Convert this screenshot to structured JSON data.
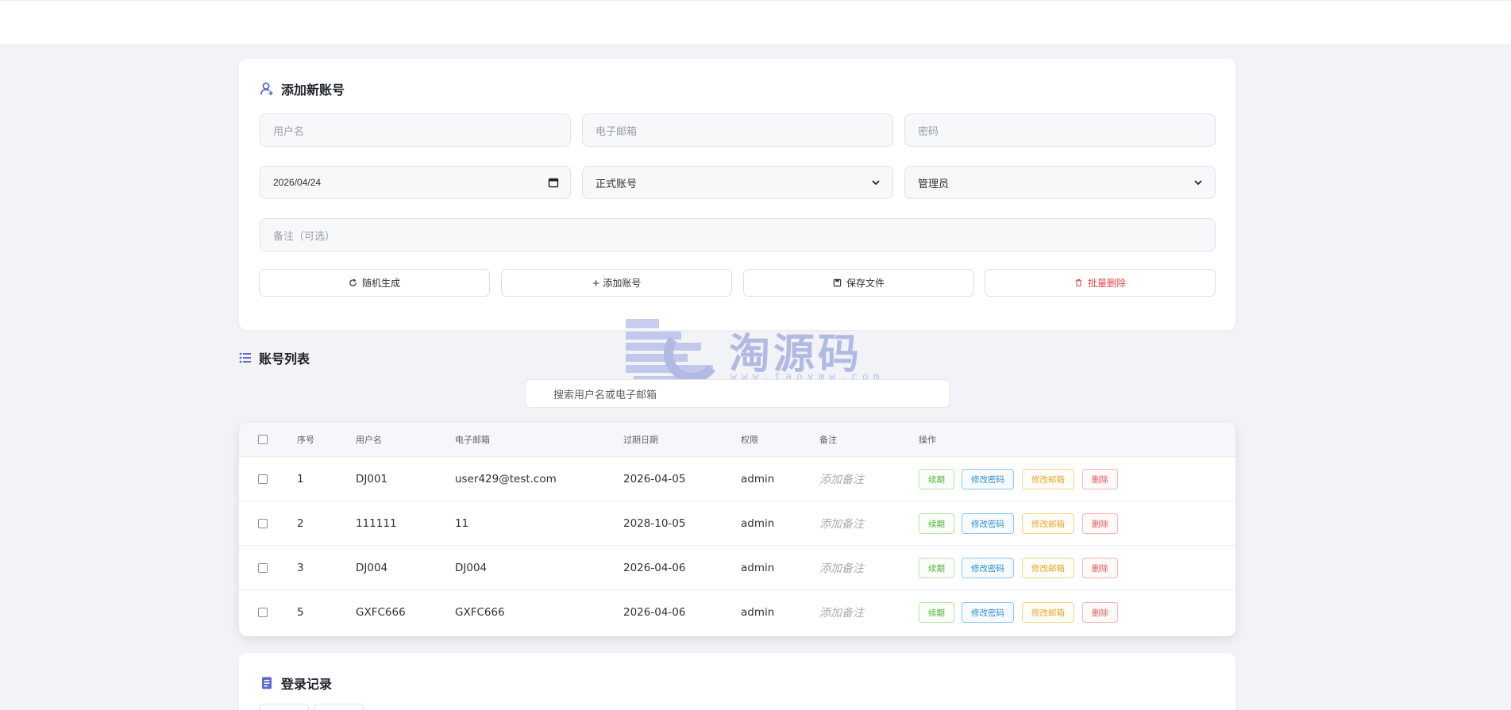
{
  "add_card": {
    "title": "添加新账号",
    "username_placeholder": "用户名",
    "email_placeholder": "电子邮箱",
    "password_placeholder": "密码",
    "date_value": "2026/04/24",
    "account_type": "正式账号",
    "role": "管理员",
    "note_placeholder": "备注（可选）",
    "buttons": {
      "random": "随机生成",
      "add": "+ 添加账号",
      "save": "保存文件",
      "batch_delete": "批量删除"
    }
  },
  "list": {
    "title": "账号列表",
    "search_placeholder": "搜索用户名或电子邮箱",
    "headers": {
      "index": "序号",
      "username": "用户名",
      "email": "电子邮箱",
      "expiry": "过期日期",
      "role": "权限",
      "note": "备注",
      "actions": "操作"
    },
    "rows": [
      {
        "index": "1",
        "username": "DJ001",
        "email": "user429@test.com",
        "expiry": "2026-04-05",
        "role": "admin",
        "note": "添加备注"
      },
      {
        "index": "2",
        "username": "111111",
        "email": "11",
        "expiry": "2028-10-05",
        "role": "admin",
        "note": "添加备注"
      },
      {
        "index": "3",
        "username": "DJ004",
        "email": "DJ004",
        "expiry": "2026-04-06",
        "role": "admin",
        "note": "添加备注"
      },
      {
        "index": "5",
        "username": "GXFC666",
        "email": "GXFC666",
        "expiry": "2026-04-06",
        "role": "admin",
        "note": "添加备注"
      }
    ],
    "actions": {
      "renew": "续期",
      "change_password": "修改密码",
      "change_email": "修改邮箱",
      "delete": "删除"
    }
  },
  "log_card": {
    "title": "登录记录"
  },
  "watermark": {
    "text": "淘源码",
    "sub": "www.taoymw.com"
  },
  "colors": {
    "accent": "#5b6bc9",
    "danger": "#e5484d",
    "background": "#f2f3f7"
  }
}
